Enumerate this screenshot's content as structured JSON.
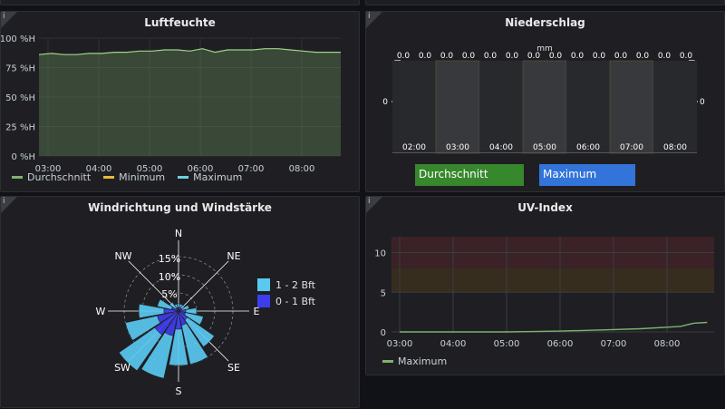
{
  "colors": {
    "background": "#111217",
    "panel": "#1f1f23",
    "humidity_line": "#7eb26d",
    "minimum": "#eab839",
    "maximum": "#6ed0e0",
    "uv_line": "#7eb26d",
    "btn_avg": "#37872d",
    "btn_max": "#3274d9",
    "wind_1_2": "#5ac8f0",
    "wind_0_1": "#3d3ded"
  },
  "humidity": {
    "title": "Luftfeuchte",
    "legend": [
      "Durchschnitt",
      "Minimum",
      "Maximum"
    ],
    "chart_data": {
      "type": "area",
      "title": "Luftfeuchte",
      "y_ticks": [
        "100 %H",
        "75 %H",
        "50 %H",
        "25 %H",
        "0 %H"
      ],
      "x_ticks": [
        "03:00",
        "04:00",
        "05:00",
        "06:00",
        "07:00",
        "08:00"
      ],
      "ylim": [
        0,
        100
      ],
      "x": [
        "02:45",
        "03:00",
        "03:15",
        "03:30",
        "03:45",
        "04:00",
        "04:15",
        "04:30",
        "04:45",
        "05:00",
        "05:15",
        "05:30",
        "05:45",
        "06:00",
        "06:15",
        "06:30",
        "06:45",
        "07:00",
        "07:15",
        "07:30",
        "07:45",
        "08:00",
        "08:15",
        "08:30",
        "08:45"
      ],
      "values": [
        86,
        87,
        86,
        86,
        87,
        87,
        88,
        88,
        89,
        89,
        90,
        90,
        89,
        91,
        88,
        90,
        90,
        90,
        91,
        91,
        90,
        89,
        88,
        88,
        88
      ],
      "series": [
        {
          "name": "Durchschnitt"
        }
      ]
    }
  },
  "precip": {
    "title": "Niederschlag",
    "unit": "mm",
    "axis_zero": "0",
    "axis_zero_right": "0",
    "x_ticks": [
      "02:00",
      "03:00",
      "04:00",
      "05:00",
      "06:00",
      "07:00",
      "08:00"
    ],
    "value_labels": [
      "0.0",
      "0.0",
      "0.0",
      "0.0",
      "0.0",
      "0.0",
      "0.0",
      "0.0",
      "0.0",
      "0.0",
      "0.0",
      "0.0",
      "0.0",
      "0.0"
    ],
    "chart_data": {
      "type": "bar",
      "categories": [
        "02:00",
        "03:00",
        "04:00",
        "05:00",
        "06:00",
        "07:00",
        "08:00"
      ],
      "series": [
        {
          "name": "Durchschnitt",
          "values": [
            0.0,
            0.0,
            0.0,
            0.0,
            0.0,
            0.0,
            0.0
          ]
        },
        {
          "name": "Maximum",
          "values": [
            0.0,
            0.0,
            0.0,
            0.0,
            0.0,
            0.0,
            0.0
          ]
        }
      ]
    },
    "btn_avg": "Durchschnitt",
    "btn_max": "Maximum"
  },
  "wind": {
    "title": "Windrichtung und Windstärke",
    "directions": [
      "N",
      "NE",
      "E",
      "SE",
      "S",
      "SW",
      "W",
      "NW"
    ],
    "rings": [
      "15%",
      "10%",
      "5%"
    ],
    "legend": [
      "1 - 2 Bft",
      "0 - 1 Bft"
    ],
    "chart_data": {
      "type": "windrose",
      "directions": [
        "N",
        "NNE",
        "NE",
        "ENE",
        "E",
        "ESE",
        "SE",
        "SSE",
        "S",
        "SSW",
        "SW",
        "WSW",
        "W",
        "WNW",
        "NW",
        "NNW"
      ],
      "series": [
        {
          "name": "1 - 2 Bft",
          "values": [
            1,
            1,
            1,
            2,
            3,
            5,
            9,
            11,
            10,
            12,
            12,
            9,
            7,
            4,
            2,
            1
          ]
        },
        {
          "name": "0 - 1 Bft",
          "values": [
            1,
            1,
            1,
            1,
            2,
            2,
            3,
            4,
            5,
            7,
            8,
            6,
            4,
            2,
            1,
            1
          ]
        }
      ]
    }
  },
  "uv": {
    "title": "UV-Index",
    "legend": "Maximum",
    "chart_data": {
      "type": "line",
      "title": "UV-Index",
      "y_ticks": [
        "10",
        "5",
        "0"
      ],
      "x_ticks": [
        "03:00",
        "04:00",
        "05:00",
        "06:00",
        "07:00",
        "08:00"
      ],
      "ylim": [
        0,
        12
      ],
      "x": [
        "03:00",
        "03:30",
        "04:00",
        "04:30",
        "05:00",
        "05:30",
        "06:00",
        "06:30",
        "07:00",
        "07:30",
        "08:00",
        "08:15",
        "08:30",
        "08:45"
      ],
      "values": [
        0,
        0,
        0,
        0,
        0,
        0.05,
        0.1,
        0.2,
        0.3,
        0.4,
        0.6,
        0.7,
        1.1,
        1.2
      ],
      "series": [
        {
          "name": "Maximum"
        }
      ]
    }
  }
}
